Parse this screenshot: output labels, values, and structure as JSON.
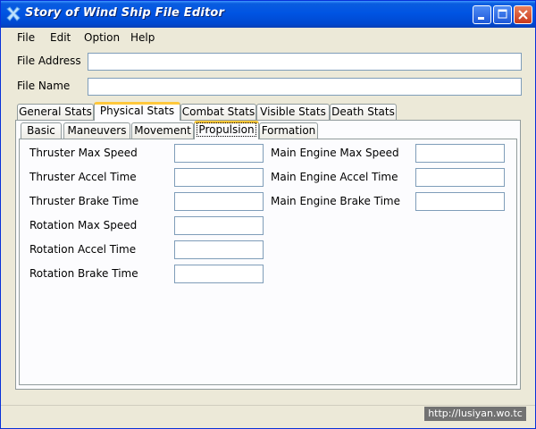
{
  "window": {
    "title": "Story of Wind Ship File Editor",
    "icon": "wind-ship-app-icon",
    "controls": [
      "minimize-icon",
      "maximize-icon",
      "close-icon"
    ]
  },
  "menu": [
    "File",
    "Edit",
    "Option",
    "Help"
  ],
  "file": {
    "address_label": "File Address",
    "address_value": "",
    "name_label": "File Name",
    "name_value": ""
  },
  "main_tabs": {
    "items": [
      "General Stats",
      "Physical Stats",
      "Combat Stats",
      "Visible Stats",
      "Death Stats"
    ],
    "selected": "Physical Stats"
  },
  "sub_tabs": {
    "items": [
      "Basic",
      "Maneuvers",
      "Movement",
      "Propulsion",
      "Formation"
    ],
    "selected": "Propulsion"
  },
  "propulsion": {
    "left": [
      {
        "label": "Thruster Max Speed",
        "value": ""
      },
      {
        "label": "Thruster Accel Time",
        "value": ""
      },
      {
        "label": "Thruster Brake Time",
        "value": ""
      },
      {
        "label": "Rotation Max Speed",
        "value": ""
      },
      {
        "label": "Rotation Accel Time",
        "value": ""
      },
      {
        "label": "Rotation Brake Time",
        "value": ""
      }
    ],
    "right": [
      {
        "label": "Main Engine Max Speed",
        "value": ""
      },
      {
        "label": "Main Engine Accel Time",
        "value": ""
      },
      {
        "label": "Main Engine Brake Time",
        "value": ""
      }
    ]
  },
  "watermark": "http://lusiyan.wo.tc",
  "colors": {
    "titlebar": "#0054e3",
    "window_bg": "#ece9d8",
    "active_tab_highlight": "#ffc83c",
    "input_border": "#7f9db9"
  }
}
